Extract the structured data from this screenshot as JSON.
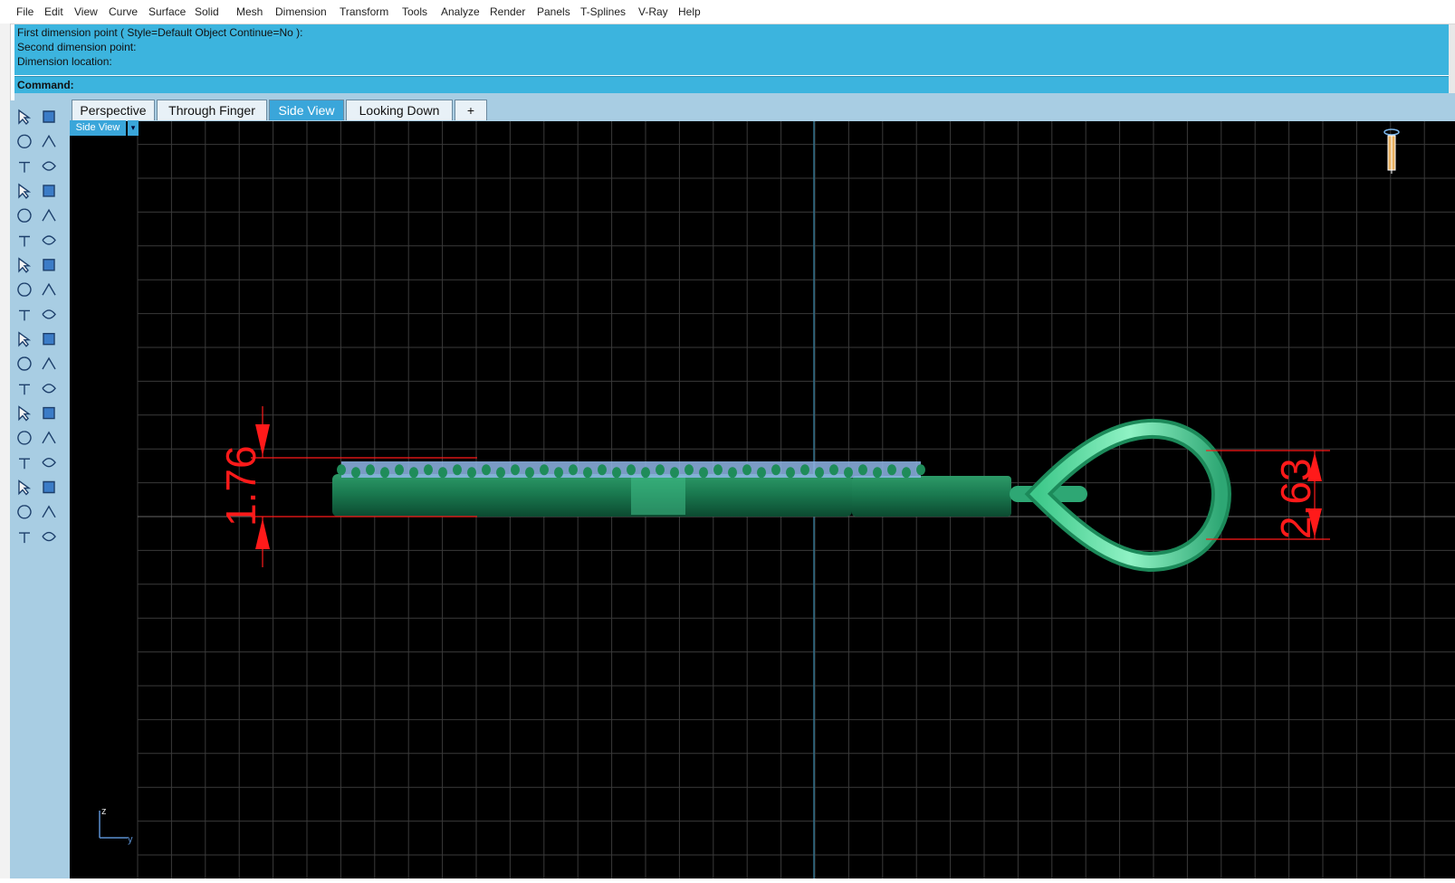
{
  "menu": [
    "File",
    "Edit",
    "View",
    "Curve",
    "Surface",
    "Solid",
    "Mesh",
    "Dimension",
    "Transform",
    "Tools",
    "Analyze",
    "Render",
    "Panels",
    "T-Splines",
    "V-Ray",
    "Help"
  ],
  "command_history": [
    "First dimension point ( Style=Default  Object  Continue=No ):",
    "Second dimension point:",
    "Dimension location:"
  ],
  "command_prompt": "Command:",
  "tabs": [
    {
      "label": "Perspective",
      "active": false
    },
    {
      "label": "Through Finger",
      "active": false
    },
    {
      "label": "Side View",
      "active": true
    },
    {
      "label": "Looking Down",
      "active": false
    }
  ],
  "add_tab_label": "+",
  "viewport": {
    "title": "Side View",
    "dropdown_glyph": "▾",
    "dimensions": [
      {
        "text": "1.76",
        "color": "#ff1a1a"
      },
      {
        "text": "2.63",
        "color": "#ff1a1a"
      }
    ],
    "axis_z": "z",
    "axis_y": "y",
    "grid_color": "#3a3a3a",
    "model_color": "#1a7a50",
    "highlight_color": "#7fe8b8"
  },
  "toolbar_icons": [
    "select-arrow-icon",
    "point-icon",
    "polyline-icon",
    "curve-icon",
    "circle-icon",
    "ellipse-icon",
    "arc-icon",
    "rectangle-icon",
    "polygon-icon",
    "fillet-curve-icon",
    "surface-from-points-icon",
    "revolve-surface-icon",
    "box-solid-icon",
    "sphere-solid-icon",
    "cylinder-solid-icon",
    "plane-surface-icon",
    "gear-transform-icon",
    "explode-icon",
    "trim-icon",
    "split-icon",
    "boolean-union-icon",
    "boolean-diff-icon",
    "bend-icon",
    "rotate-icon",
    "text-icon",
    "scale-icon",
    "array-icon",
    "mirror-icon",
    "solid-box-blue-icon",
    "dimension-icon",
    "grid-array-icon",
    "align-icon",
    "paste-icon",
    "check-icon",
    "analyze-shape-icon",
    "render-icon"
  ]
}
